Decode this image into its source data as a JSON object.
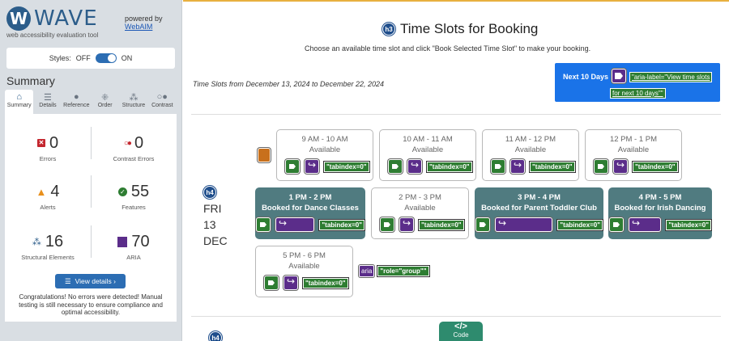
{
  "wave": {
    "logo_letter": "W",
    "logo_text": "WAVE",
    "logo_sub": "web accessibility evaluation tool",
    "powered_by": "powered by",
    "webaim_link": "WebAIM",
    "styles_label": "Styles:",
    "off_label": "OFF",
    "on_label": "ON",
    "summary_title": "Summary",
    "tabs": [
      {
        "label": "Summary",
        "icon": "home-icon"
      },
      {
        "label": "Details",
        "icon": "list-icon"
      },
      {
        "label": "Reference",
        "icon": "info-icon"
      },
      {
        "label": "Order",
        "icon": "order-icon"
      },
      {
        "label": "Structure",
        "icon": "structure-icon"
      },
      {
        "label": "Contrast",
        "icon": "contrast-icon"
      }
    ],
    "stats": {
      "errors": {
        "value": "0",
        "label": "Errors"
      },
      "contrast": {
        "value": "0",
        "label": "Contrast Errors"
      },
      "alerts": {
        "value": "4",
        "label": "Alerts"
      },
      "features": {
        "value": "55",
        "label": "Features"
      },
      "structural": {
        "value": "16",
        "label": "Structural Elements"
      },
      "aria": {
        "value": "70",
        "label": "ARIA"
      }
    },
    "view_details": "View details ›",
    "congrats": "Congratulations! No errors were detected! Manual testing is still necessary to ensure compliance and optimal accessibility."
  },
  "page": {
    "heading_badge": "h3",
    "title": "Time Slots for Booking",
    "subtitle": "Choose an available time slot and click \"Book Selected Time Slot\" to make your booking.",
    "range": "Time Slots from December 13, 2024 to December 22, 2024",
    "next_button": "Next 10 Days",
    "next_aria_1": "\"aria-label=\"View time slots",
    "next_aria_2": "for next 10 days\"\"",
    "day_badge": "h4",
    "day_name": "FRI",
    "day_num": "13",
    "day_month": "DEC",
    "tabindex_chip": "\"tabindex=0\"",
    "role_chip": "\"role=\"group\"\"",
    "aria_badge": "aria",
    "next_day_badge": "h4",
    "code_label": "Code",
    "code_glyph": "</>",
    "slots": [
      {
        "time": "9 AM - 10 AM",
        "status": "Available"
      },
      {
        "time": "10 AM - 11 AM",
        "status": "Available"
      },
      {
        "time": "11 AM - 12 PM",
        "status": "Available"
      },
      {
        "time": "12 PM - 1 PM",
        "status": "Available"
      },
      {
        "time": "1 PM - 2 PM",
        "status": "Booked for Dance Classes"
      },
      {
        "time": "2 PM - 3 PM",
        "status": "Available"
      },
      {
        "time": "3 PM - 4 PM",
        "status": "Booked for Parent Toddler Club"
      },
      {
        "time": "4 PM - 5 PM",
        "status": "Booked for Irish Dancing"
      },
      {
        "time": "5 PM - 6 PM",
        "status": "Available"
      }
    ]
  },
  "colors": {
    "booked": "#507b80",
    "accent_blue": "#1a73e8",
    "wave_blue": "#2c5d8a",
    "tag_green": "#2e7d32",
    "aria_purple": "#5b2d8a"
  }
}
